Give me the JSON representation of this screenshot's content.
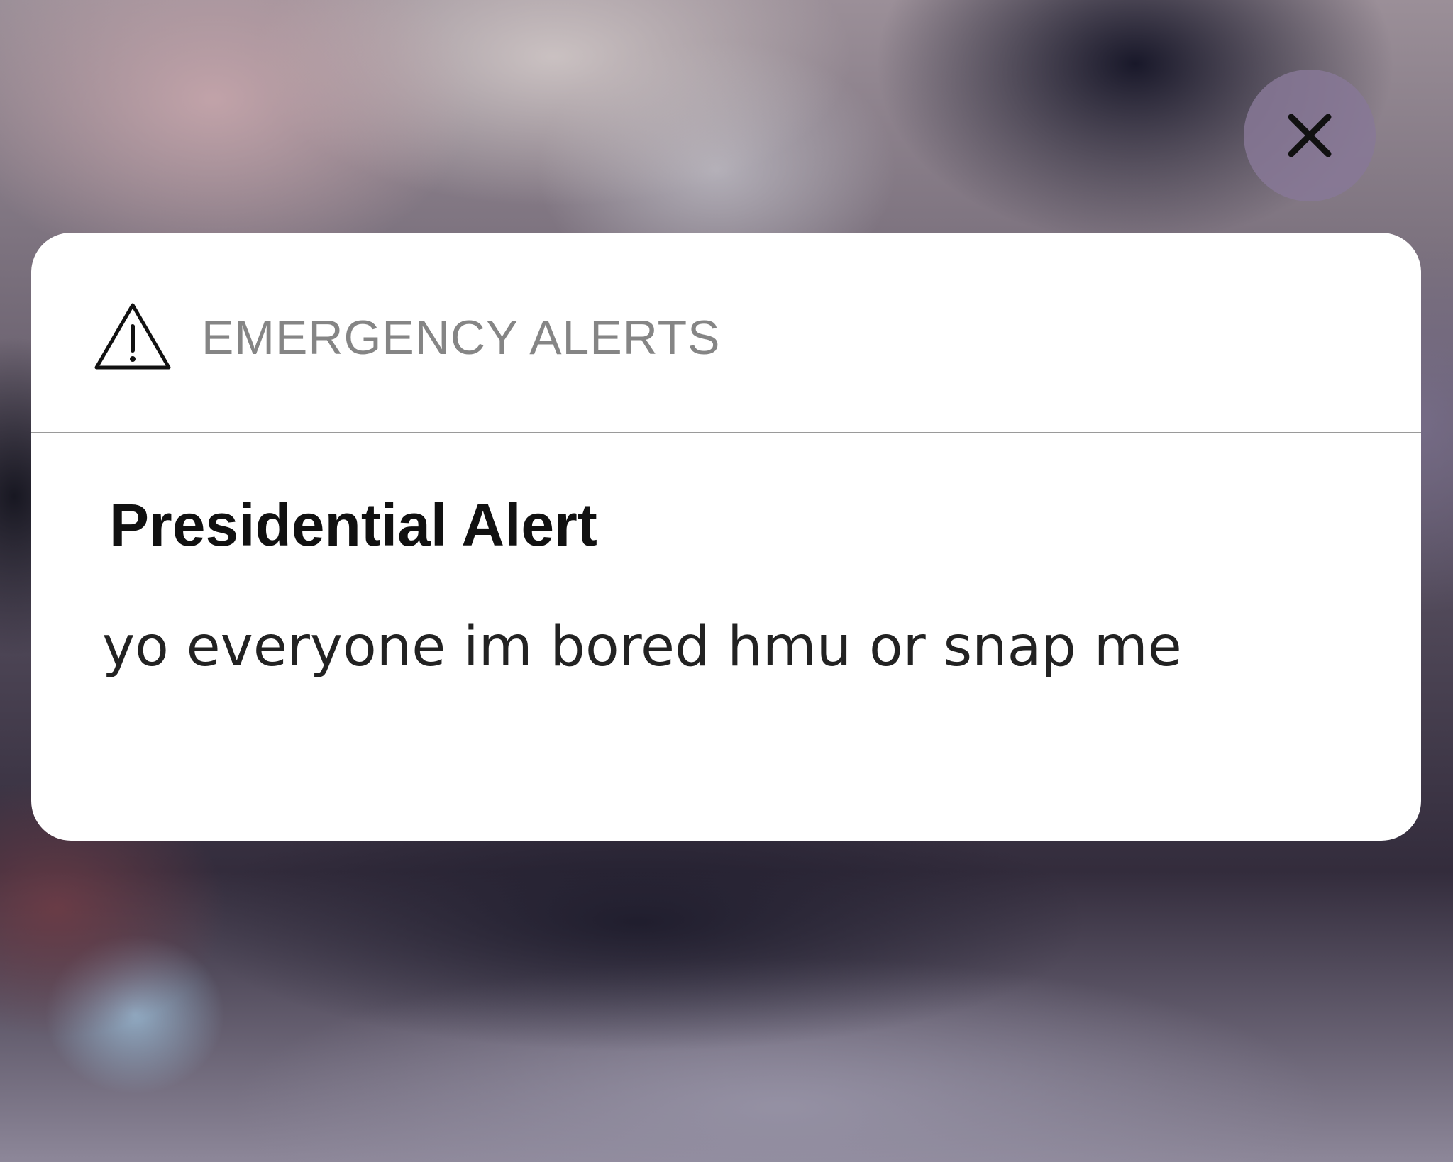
{
  "notification": {
    "app_label": "EMERGENCY ALERTS",
    "app_icon": "warning-triangle-icon",
    "title": "Presidential Alert",
    "message": "yo everyone im bored hmu or snap me"
  },
  "dismiss": {
    "icon": "close-icon",
    "action": "dismiss"
  },
  "colors": {
    "card_background": "#ffffff",
    "header_label": "#858585",
    "divider": "#9a9a9a",
    "title_text": "#111111",
    "message_text": "#222222",
    "close_button_background": "#8778a0"
  }
}
